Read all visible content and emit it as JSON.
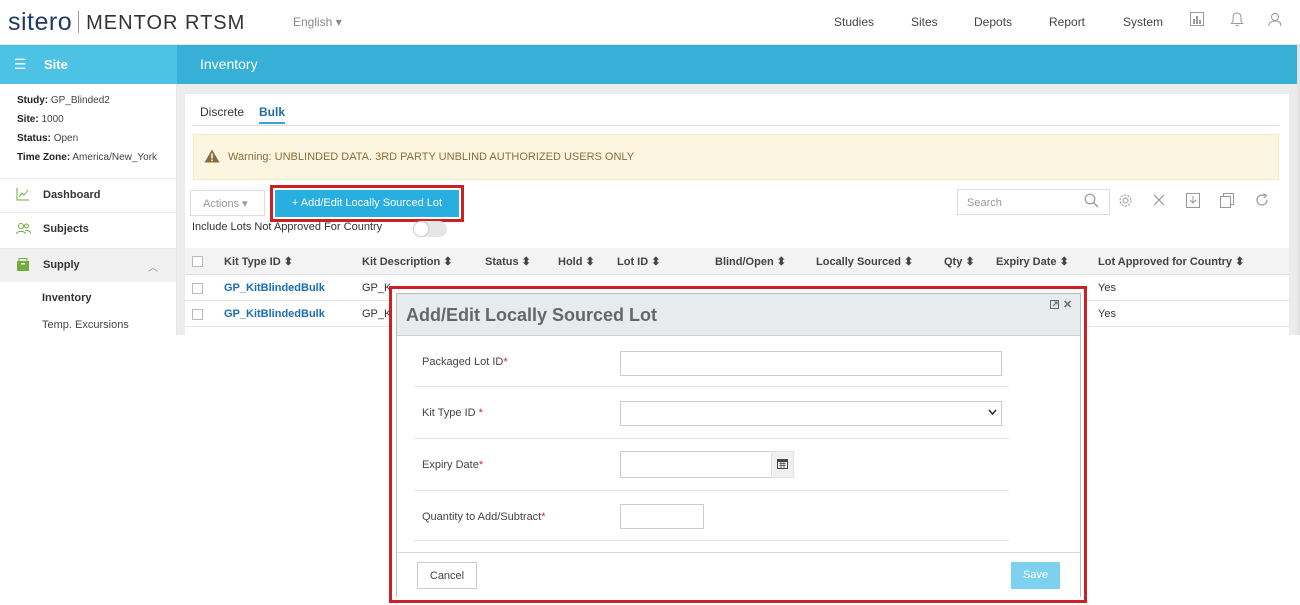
{
  "brand": {
    "logo": "sitero",
    "product": "MENTOR RTSM"
  },
  "header": {
    "language": "English",
    "nav": [
      "Studies",
      "Sites",
      "Depots",
      "Report",
      "System"
    ]
  },
  "sidebar": {
    "title": "Site",
    "info": [
      {
        "label": "Study:",
        "value": "GP_Blinded2"
      },
      {
        "label": "Site:",
        "value": "1000"
      },
      {
        "label": "Status:",
        "value": "Open"
      },
      {
        "label": "Time Zone:",
        "value": "America/New_York"
      }
    ],
    "items": [
      {
        "label": "Dashboard",
        "icon": "chart-line-icon"
      },
      {
        "label": "Subjects",
        "icon": "users-icon"
      },
      {
        "label": "Supply",
        "icon": "box-icon"
      }
    ],
    "subitems": [
      "Inventory",
      "Temp. Excursions"
    ]
  },
  "page": {
    "title": "Inventory",
    "tabs": [
      "Discrete",
      "Bulk"
    ],
    "warning": "Warning: UNBLINDED DATA. 3RD PARTY UNBLIND AUTHORIZED USERS ONLY",
    "actions_label": "Actions",
    "add_button": "+ Add/Edit Locally Sourced Lot",
    "toggle_label": "Include Lots Not Approved For Country",
    "search_placeholder": "Search"
  },
  "table": {
    "columns": [
      "Kit Type ID",
      "Kit Description",
      "Status",
      "Hold",
      "Lot ID",
      "Blind/Open",
      "Locally Sourced",
      "Qty",
      "Expiry Date",
      "Lot Approved for Country"
    ],
    "rows": [
      {
        "kit_type": "GP_KitBlindedBulk",
        "kit_desc": "GP_K",
        "approved": "Yes"
      },
      {
        "kit_type": "GP_KitBlindedBulk",
        "kit_desc": "GP_K",
        "approved": "Yes"
      }
    ]
  },
  "modal": {
    "title": "Add/Edit Locally Sourced Lot",
    "fields": {
      "packaged_lot": "Packaged Lot ID",
      "kit_type": "Kit Type ID ",
      "expiry": "Expiry Date",
      "quantity": "Quantity to Add/Subtract"
    },
    "required_mark": "*",
    "cancel": "Cancel",
    "save": "Save"
  }
}
